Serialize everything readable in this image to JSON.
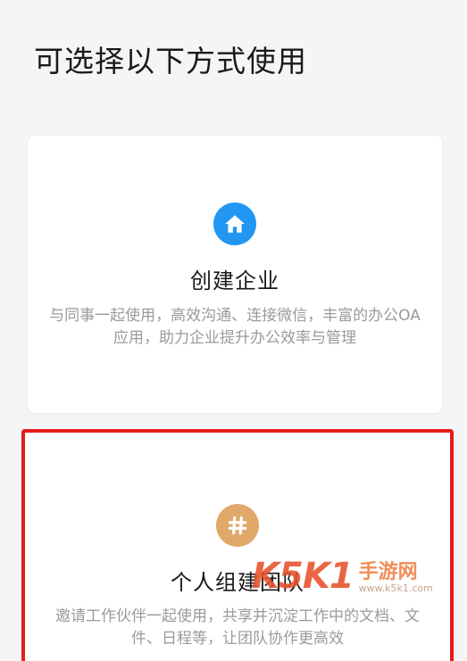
{
  "page": {
    "title": "可选择以下方式使用"
  },
  "options": {
    "enterprise": {
      "icon": "home-icon",
      "icon_color": "#2196f3",
      "title": "创建企业",
      "description": "与同事一起使用，高效沟通、连接微信，丰富的办公OA应用，助力企业提升办公效率与管理"
    },
    "team": {
      "icon": "hash-icon",
      "icon_color": "#e0a86a",
      "title": "个人组建团队",
      "description": "邀请工作伙伴一起使用，共享并沉淀工作中的文档、文件、日程等，让团队协作更高效",
      "highlight_color": "#e51c1c"
    }
  },
  "watermark": {
    "brand": "K5K1",
    "cn": "手游网",
    "url": "www.k5k1.com"
  }
}
